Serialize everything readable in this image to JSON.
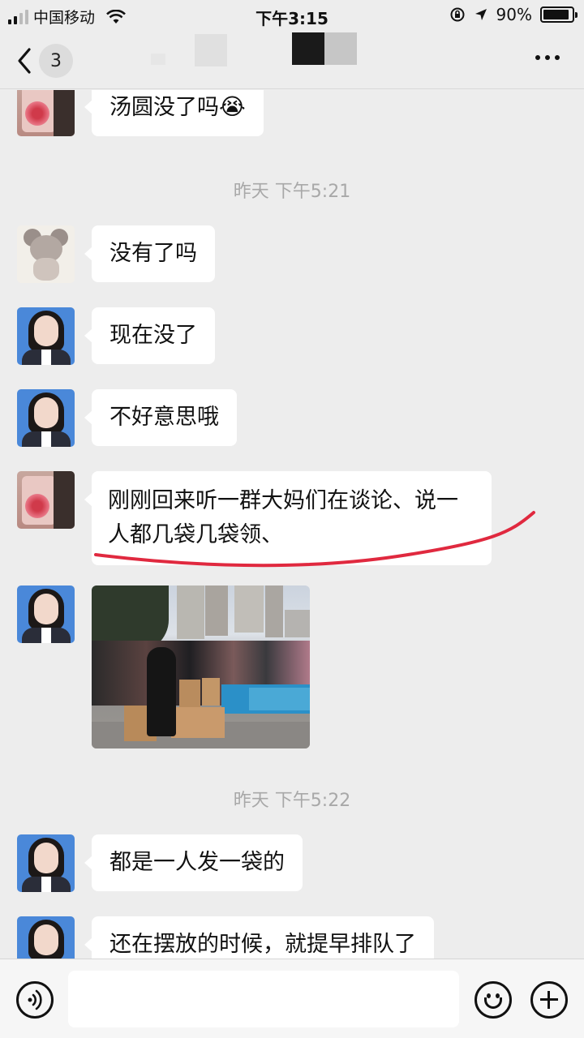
{
  "status_bar": {
    "carrier": "中国移动",
    "time": "下午3:15",
    "battery_percent": "90%",
    "battery_level": 0.9
  },
  "nav": {
    "unread_count": "3"
  },
  "messages": [
    {
      "text": "汤圆没了吗",
      "emoji": "😭"
    },
    {
      "text": "没有了吗"
    },
    {
      "text": "现在没了"
    },
    {
      "text": "不好意思哦"
    },
    {
      "text": "刚刚回来听一群大妈们在谈论、说一人都几袋几袋领、"
    },
    {
      "text": "都是一人发一袋的"
    },
    {
      "text": "还在摆放的时候，就提早排队了"
    }
  ],
  "timestamps": [
    "昨天 下午5:21",
    "昨天 下午5:22"
  ],
  "icons": {
    "back": "chevron-left-icon",
    "more": "more-dots-icon",
    "voice": "voice-icon",
    "emoji": "emoji-icon",
    "plus": "plus-icon",
    "annotation": "red-underline-annotation"
  },
  "colors": {
    "background": "#ededed",
    "bubble": "#ffffff",
    "annotation": "#e0293f"
  }
}
